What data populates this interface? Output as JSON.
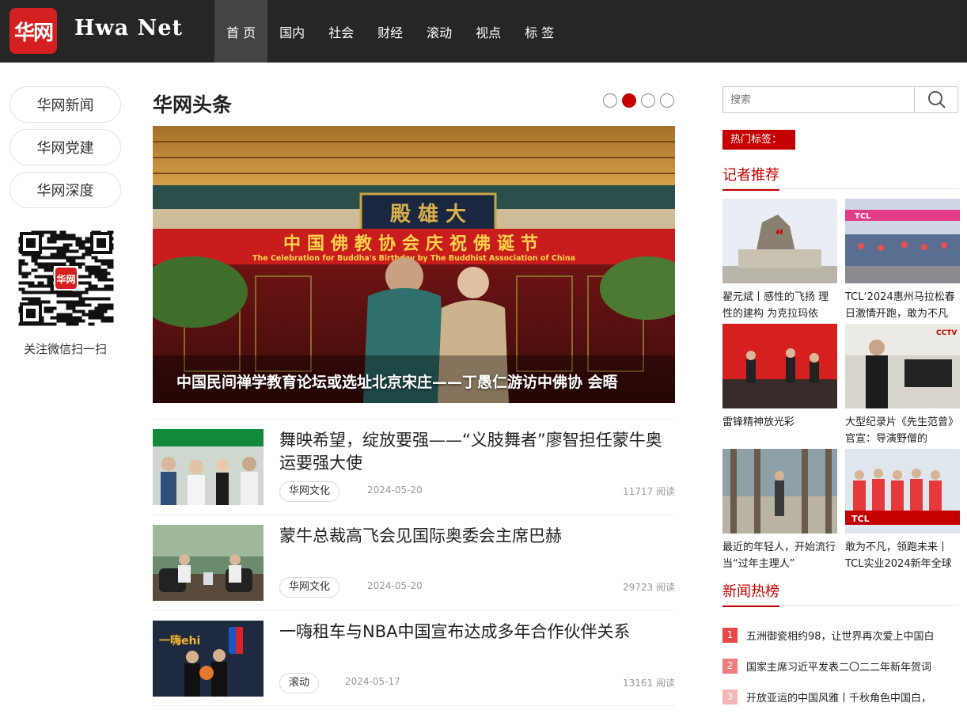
{
  "header": {
    "logo_text": "华网",
    "brand": "Hwa Net",
    "nav": [
      "首 页",
      "国内",
      "社会",
      "财经",
      "滚动",
      "视点",
      "标 签"
    ]
  },
  "left": {
    "pills": [
      "华网新闻",
      "华网党建",
      "华网深度"
    ],
    "qr_logo_text": "华网",
    "qr_caption": "关注微信扫一扫"
  },
  "main": {
    "section_title": "华网头条",
    "carousel_active_index": 1,
    "hero": {
      "banner_cn": "中国佛教协会庆祝佛诞节",
      "banner_en": "The Celebration for Buddha's Birthday by The Buddhist Association of China",
      "plaque": "殿 雄 大",
      "caption": "中国民间禅学教育论坛或选址北京宋庄——丁愚仁游访中佛协 会晤"
    },
    "articles": [
      {
        "title": "舞映希望，绽放要强——“义肢舞者”廖智担任蒙牛奥运要强大使",
        "tag": "华网文化",
        "date": "2024-05-20",
        "reads": "11717 阅读"
      },
      {
        "title": "蒙牛总裁高飞会见国际奥委会主席巴赫",
        "tag": "华网文化",
        "date": "2024-05-20",
        "reads": "29723 阅读"
      },
      {
        "title": "一嗨租车与NBA中国宣布达成多年合作伙伴关系",
        "tag": "滚动",
        "date": "2024-05-17",
        "reads": "13161 阅读",
        "thumb_text": "一嗨ehi"
      }
    ]
  },
  "right": {
    "search_placeholder": "搜索",
    "hot_tags_label": "热门标签：",
    "reporter_title": "记者推荐",
    "cards": [
      {
        "caption": "翟元斌丨感性的飞扬 理性的建构 为克拉玛依",
        "pic_text": "“"
      },
      {
        "caption": "TCL‘2024惠州马拉松春日激情开跑，敢为不凡",
        "pic_text": "TCL"
      },
      {
        "caption": "雷锋精神放光彩",
        "pic_text": ""
      },
      {
        "caption": "大型纪录片《先生范曾》官宣：导演野僧的",
        "pic_text": "CCTV"
      },
      {
        "caption": "最近的年轻人，开始流行当“过年主理人”",
        "pic_text": ""
      },
      {
        "caption": "敢为不凡，领跑未来丨TCL实业2024新年全球",
        "pic_text": "TCL"
      }
    ],
    "hotlist_title": "新闻热榜",
    "hotlist": [
      {
        "rank": "1",
        "text": "五洲御瓷相约98，让世界再次爱上中国白",
        "color": "#e8474a"
      },
      {
        "rank": "2",
        "text": "国家主席习近平发表二〇二二年新年贺词",
        "color": "#f07d7d"
      },
      {
        "rank": "3",
        "text": "开放亚运的中国风雅丨千秋角色中国白，",
        "color": "#f6b5b5"
      }
    ]
  },
  "colors": {
    "accent": "#c40000",
    "topbar": "#262626"
  }
}
